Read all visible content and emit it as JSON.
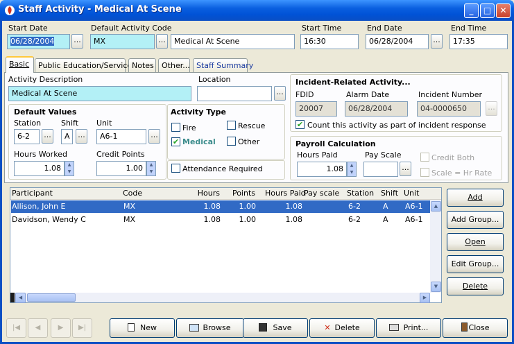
{
  "window": {
    "title": "Staff Activity  -  Medical At Scene"
  },
  "header": {
    "start_date_label": "Start Date",
    "start_date_value": "06/28/2004",
    "default_code_label": "Default Activity Code",
    "default_code_value": "MX",
    "default_code_desc": "Medical At Scene",
    "start_time_label": "Start Time",
    "start_time_value": "16:30",
    "end_date_label": "End Date",
    "end_date_value": "06/28/2004",
    "end_time_label": "End Time",
    "end_time_value": "17:35",
    "dots": "..."
  },
  "tabs": [
    "Basic",
    "Public Education/Service",
    "Notes",
    "Other...",
    "Staff Summary"
  ],
  "basic": {
    "activity_desc_label": "Activity Description",
    "activity_desc_value": "Medical At Scene",
    "location_label": "Location",
    "location_value": "",
    "default_values_title": "Default Values",
    "station_label": "Station",
    "station_value": "6-2",
    "shift_label": "Shift",
    "shift_value": "A",
    "unit_label": "Unit",
    "unit_value": "A6-1",
    "hours_worked_label": "Hours Worked",
    "hours_worked_value": "1.08",
    "credit_points_label": "Credit Points",
    "credit_points_value": "1.00",
    "activity_type_title": "Activity Type",
    "type_fire": "Fire",
    "type_rescue": "Rescue",
    "type_medical": "Medical",
    "type_other": "Other",
    "attendance_required": "Attendance Required",
    "incident_title": "Incident-Related Activity...",
    "fdid_label": "FDID",
    "fdid_value": "20007",
    "alarm_date_label": "Alarm Date",
    "alarm_date_value": "06/28/2004",
    "incident_number_label": "Incident Number",
    "incident_number_value": "04-0000650",
    "count_activity": "Count this activity as part of incident response",
    "payroll_title": "Payroll Calculation",
    "hours_paid_label": "Hours Paid",
    "hours_paid_value": "1.08",
    "pay_scale_label": "Pay Scale",
    "pay_scale_value": "",
    "credit_both": "Credit Both",
    "scale_hr_rate": "Scale = Hr Rate"
  },
  "grid": {
    "columns": [
      "Participant",
      "Code",
      "Hours",
      "Points",
      "Hours Paid",
      "Pay scale",
      "Station",
      "Shift",
      "Unit"
    ],
    "rows": [
      {
        "participant": "Allison, John E",
        "code": "MX",
        "hours": "1.08",
        "points": "1.00",
        "hours_paid": "1.08",
        "pay_scale": "",
        "station": "6-2",
        "shift": "A",
        "unit": "A6-1"
      },
      {
        "participant": "Davidson, Wendy C",
        "code": "MX",
        "hours": "1.08",
        "points": "1.00",
        "hours_paid": "1.08",
        "pay_scale": "",
        "station": "6-2",
        "shift": "A",
        "unit": "A6-1"
      }
    ]
  },
  "side_buttons": [
    "Add",
    "Add Group...",
    "Open",
    "Edit Group...",
    "Delete"
  ],
  "bottom_buttons": [
    "New",
    "Browse",
    "Save",
    "Delete",
    "Print...",
    "Close"
  ],
  "colors": {
    "selection": "#316ac5",
    "required_field": "#b3f0f6",
    "title_bar": "#0a5fe0"
  }
}
